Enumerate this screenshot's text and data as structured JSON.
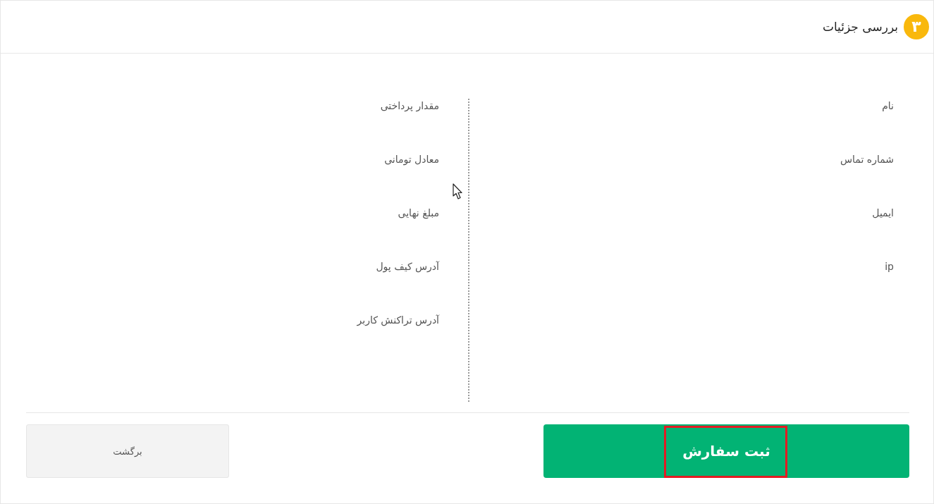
{
  "header": {
    "step": "۳",
    "title": "بررسی جزئیات"
  },
  "details": {
    "right_column": [
      "نام",
      "شماره تماس",
      "ایمیل",
      "ip"
    ],
    "left_column": [
      "مقدار پرداختی",
      "معادل تومانی",
      "مبلغ نهایی",
      "آدرس کیف پول",
      "آدرس تراکنش کاربر"
    ]
  },
  "actions": {
    "submit": {
      "label": "ثبت سفارش",
      "highlighted": true
    },
    "back": {
      "label": "برگشت"
    }
  }
}
